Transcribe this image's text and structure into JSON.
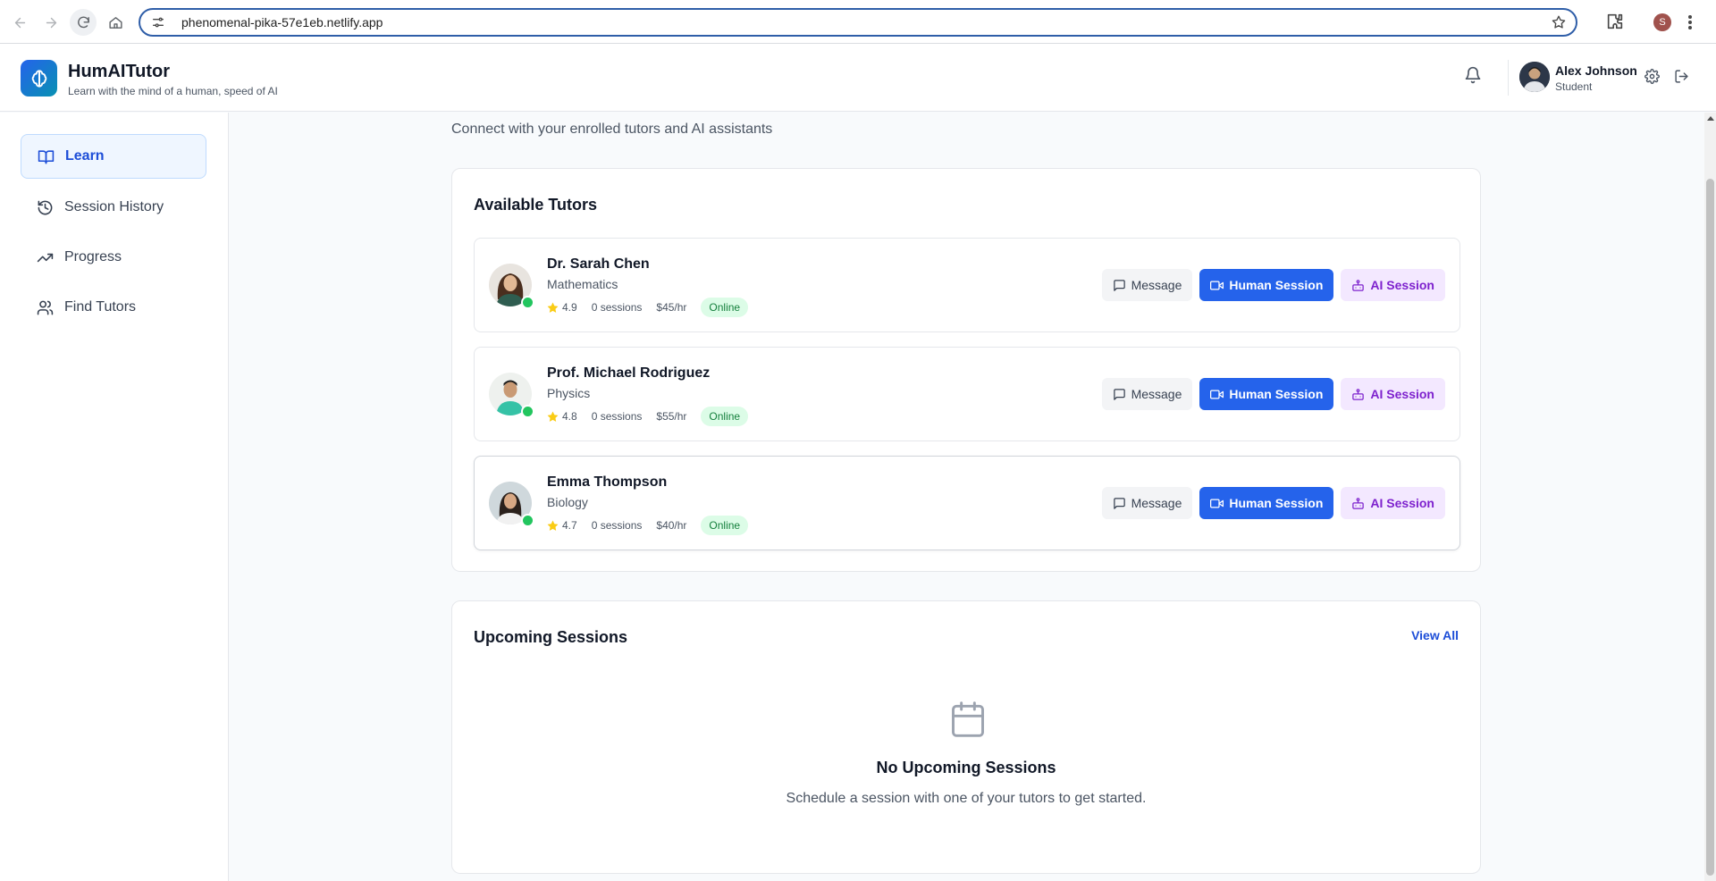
{
  "browser": {
    "url": "phenomenal-pika-57e1eb.netlify.app",
    "profile_initial": "S"
  },
  "header": {
    "brand_name": "HumAITutor",
    "tagline": "Learn with the mind of a human, speed of AI",
    "user_name": "Alex Johnson",
    "user_role": "Student"
  },
  "sidebar": {
    "items": [
      {
        "label": "Learn",
        "icon": "book-open-icon",
        "active": true
      },
      {
        "label": "Session History",
        "icon": "history-icon",
        "active": false
      },
      {
        "label": "Progress",
        "icon": "trending-up-icon",
        "active": false
      },
      {
        "label": "Find Tutors",
        "icon": "users-icon",
        "active": false
      }
    ]
  },
  "main": {
    "subtitle": "Connect with your enrolled tutors and AI assistants",
    "tutors_card": {
      "title": "Available Tutors",
      "tutors": [
        {
          "name": "Dr. Sarah Chen",
          "subject": "Mathematics",
          "rating": "4.9",
          "sessions": "0 sessions",
          "rate": "$45/hr",
          "status": "Online"
        },
        {
          "name": "Prof. Michael Rodriguez",
          "subject": "Physics",
          "rating": "4.8",
          "sessions": "0 sessions",
          "rate": "$55/hr",
          "status": "Online"
        },
        {
          "name": "Emma Thompson",
          "subject": "Biology",
          "rating": "4.7",
          "sessions": "0 sessions",
          "rate": "$40/hr",
          "status": "Online"
        }
      ],
      "buttons": {
        "message": "Message",
        "human_session": "Human Session",
        "ai_session": "AI Session"
      }
    },
    "upcoming_card": {
      "title": "Upcoming Sessions",
      "view_all": "View All",
      "empty_title": "No Upcoming Sessions",
      "empty_subtitle": "Schedule a session with one of your tutors to get started."
    }
  },
  "colors": {
    "primary": "#2563eb",
    "ai_accent": "#7e22ce",
    "online_green": "#22c55e",
    "star": "#facc15"
  }
}
